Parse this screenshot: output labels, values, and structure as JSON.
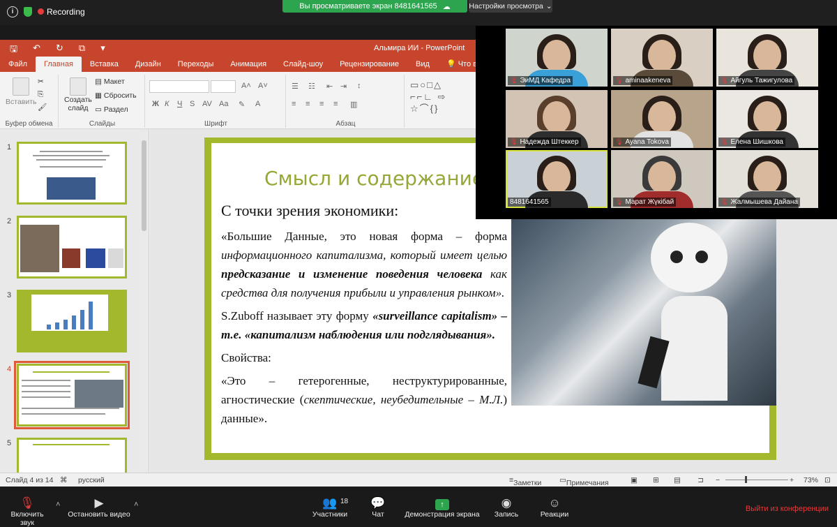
{
  "zoom": {
    "recording_label": "Recording",
    "viewing_banner": "Вы просматриваете экран 8481641565",
    "view_settings": "Настройки просмотра",
    "participants_count": "18",
    "toolbar": {
      "mute": "Включить звук",
      "video": "Остановить видео",
      "participants": "Участники",
      "chat": "Чат",
      "share": "Демонстрация экрана",
      "record": "Запись",
      "reactions": "Реакции",
      "leave": "Выйти из конференции"
    },
    "participants": [
      {
        "name": "ЭиМД Кафедра",
        "muted": true
      },
      {
        "name": "aminaakeneva",
        "muted": true
      },
      {
        "name": "Айгуль Тажигулова",
        "muted": true
      },
      {
        "name": "Надежда Штеккер",
        "muted": true
      },
      {
        "name": "Ayana Tokova",
        "muted": true
      },
      {
        "name": "Елена Шишкова",
        "muted": true
      },
      {
        "name": "8481641565",
        "muted": false
      },
      {
        "name": "Марат Жүкібай",
        "muted": true
      },
      {
        "name": "Жалмышева Дайана",
        "muted": true
      }
    ]
  },
  "ppt": {
    "doc_title": "Альмира ИИ - PowerPoint",
    "tabs": [
      "Файл",
      "Главная",
      "Вставка",
      "Дизайн",
      "Переходы",
      "Анимация",
      "Слайд-шоу",
      "Рецензирование",
      "Вид",
      "Что вы"
    ],
    "ribbon": {
      "paste": "Вставить",
      "clipboard": "Буфер обмена",
      "new_slide": "Создать",
      "new_slide_2": "слайд",
      "layout": "Макет",
      "reset": "Сбросить",
      "section": "Раздел",
      "slides_group": "Слайды",
      "font_group": "Шрифт",
      "paragraph_group": "Абзац"
    },
    "slides": [
      "1",
      "2",
      "3",
      "4",
      "5"
    ],
    "slide": {
      "title": "Смысл и содержание",
      "heading": "С точки зрения экономики:",
      "p1_a": "«Большие Данные, это новая форма – форма ",
      "p1_b": "информационного капитализма, который имеет целью ",
      "p1_c": "предсказание и изменение поведения человека",
      "p1_d": " как средства для получения прибыли и управления рынком».",
      "p2_a": "S.Zuboff называет эту форму ",
      "p2_b": "«surveillance capitalism» – т.е. «капитализм наблюдения или подглядывания».",
      "p3": "Свойства:",
      "p4_a": "«Это – гетерогенные, неструктурированные, агностические (",
      "p4_b": "скептические, неубедительные – М.Л.",
      "p4_c": ") данные»."
    },
    "status": {
      "slide_of": "Слайд 4 из 14",
      "language": "русский",
      "notes": "Заметки",
      "comments": "Примечания",
      "zoom": "73%"
    }
  }
}
